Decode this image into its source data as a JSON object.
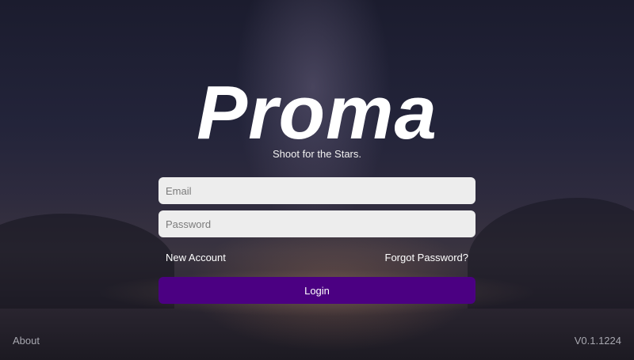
{
  "branding": {
    "logo_text": "Proma",
    "tagline": "Shoot for the Stars."
  },
  "form": {
    "email_placeholder": "Email",
    "password_placeholder": "Password",
    "new_account_label": "New Account",
    "forgot_password_label": "Forgot Password?",
    "login_label": "Login"
  },
  "footer": {
    "about_label": "About",
    "version": "V0.1.1224"
  },
  "colors": {
    "login_button": "#4b0082",
    "input_background": "#ededed"
  }
}
